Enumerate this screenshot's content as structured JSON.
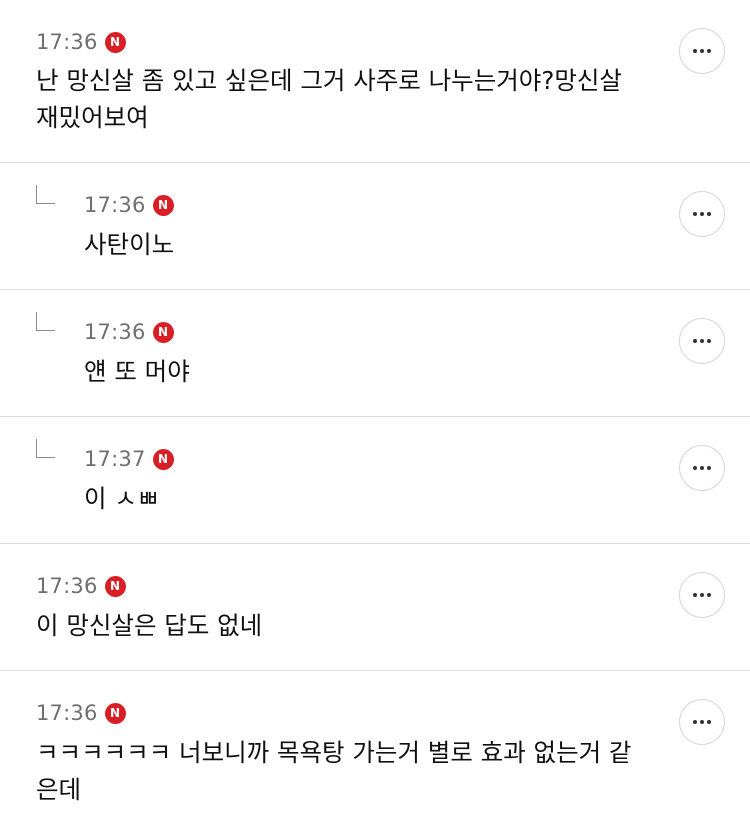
{
  "comments": [
    {
      "time": "17:36",
      "badge": "N",
      "text": "난 망신살 좀 있고 싶은데 그거 사주로 나누는거야?망신살\n재밌어보여",
      "is_reply": false,
      "more_label": "more-options"
    },
    {
      "time": "17:36",
      "badge": "N",
      "text": "사탄이노",
      "is_reply": true,
      "more_label": "more-options"
    },
    {
      "time": "17:36",
      "badge": "N",
      "text": "얜 또 머야",
      "is_reply": true,
      "more_label": "more-options"
    },
    {
      "time": "17:37",
      "badge": "N",
      "text": "이 ㅅㅃ",
      "is_reply": true,
      "more_label": "more-options"
    },
    {
      "time": "17:36",
      "badge": "N",
      "text": "이 망신살은 답도 없네",
      "is_reply": false,
      "more_label": "more-options"
    },
    {
      "time": "17:36",
      "badge": "N",
      "text": "ㅋㅋㅋㅋㅋㅋ 너보니까 목욕탕 가는거 별로 효과 없는거 같\n은데",
      "is_reply": false,
      "more_label": "more-options"
    }
  ],
  "colors": {
    "badge": "#d81f26",
    "time": "#6f6f6f",
    "divider": "#dcdcdc",
    "text": "#111111"
  },
  "icons": {
    "badge": "new-badge-icon",
    "more": "more-dots-icon",
    "reply": "reply-arrow-icon"
  }
}
